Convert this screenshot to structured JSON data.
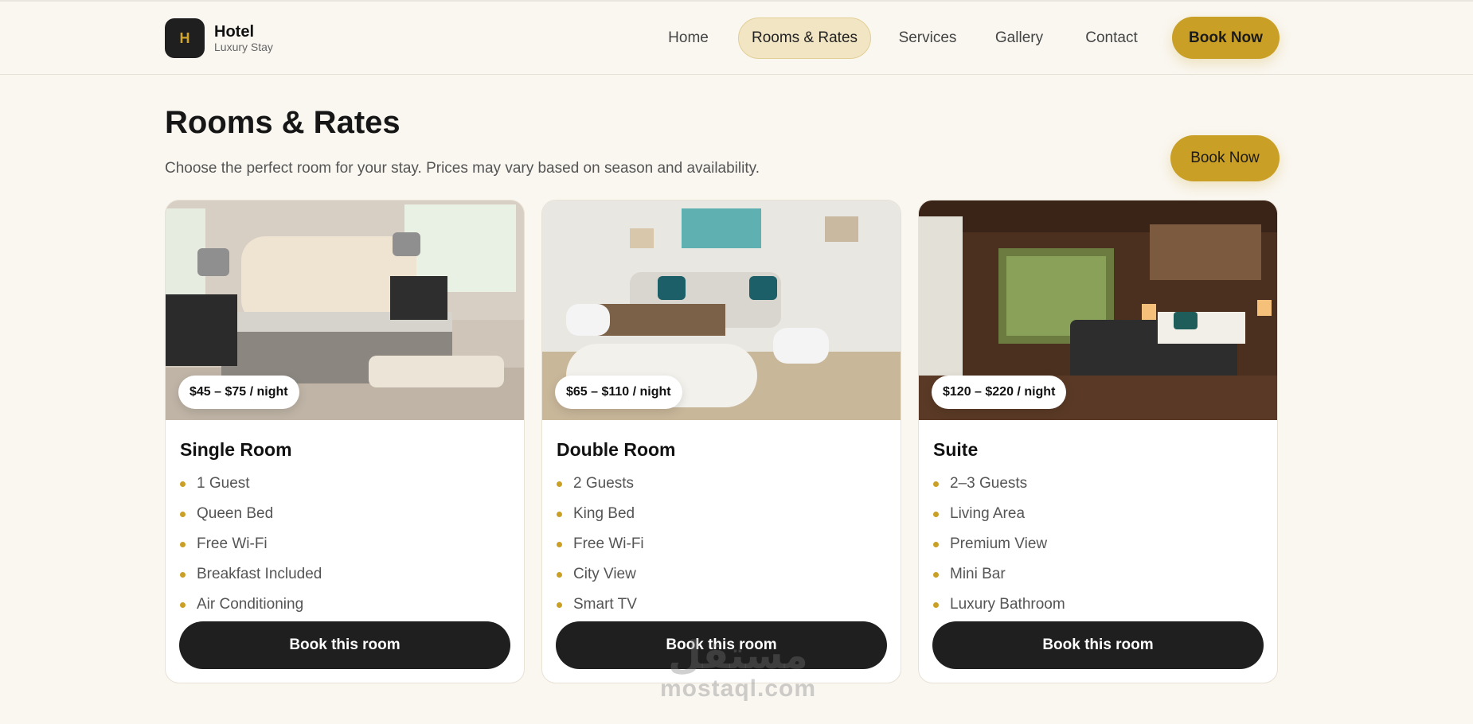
{
  "header": {
    "logo": {
      "badge": "H",
      "title": "Hotel",
      "subtitle": "Luxury Stay"
    },
    "nav": [
      {
        "label": "Home",
        "active": false
      },
      {
        "label": "Rooms & Rates",
        "active": true
      },
      {
        "label": "Services",
        "active": false
      },
      {
        "label": "Gallery",
        "active": false
      },
      {
        "label": "Contact",
        "active": false
      }
    ],
    "cta_label": "Book Now"
  },
  "hero": {
    "title": "Rooms & Rates",
    "subtitle": "Choose the perfect room for your stay. Prices may vary based on season and availability.",
    "cta_label": "Book Now"
  },
  "rooms": [
    {
      "price": "$45 – $75 / night",
      "title": "Single Room",
      "features": [
        "1 Guest",
        "Queen Bed",
        "Free Wi-Fi",
        "Breakfast Included",
        "Air Conditioning"
      ],
      "button": "Book this room"
    },
    {
      "price": "$65 – $110 / night",
      "title": "Double Room",
      "features": [
        "2 Guests",
        "King Bed",
        "Free Wi-Fi",
        "City View",
        "Smart TV"
      ],
      "button": "Book this room"
    },
    {
      "price": "$120 – $220 / night",
      "title": "Suite",
      "features": [
        "2–3 Guests",
        "Living Area",
        "Premium View",
        "Mini Bar",
        "Luxury Bathroom"
      ],
      "button": "Book this room"
    }
  ],
  "watermark": {
    "main": "مستقل",
    "sub": "mostaql.com"
  },
  "colors": {
    "accent": "#c99f25",
    "dark": "#1f1f1f",
    "background": "#faf7f1"
  }
}
